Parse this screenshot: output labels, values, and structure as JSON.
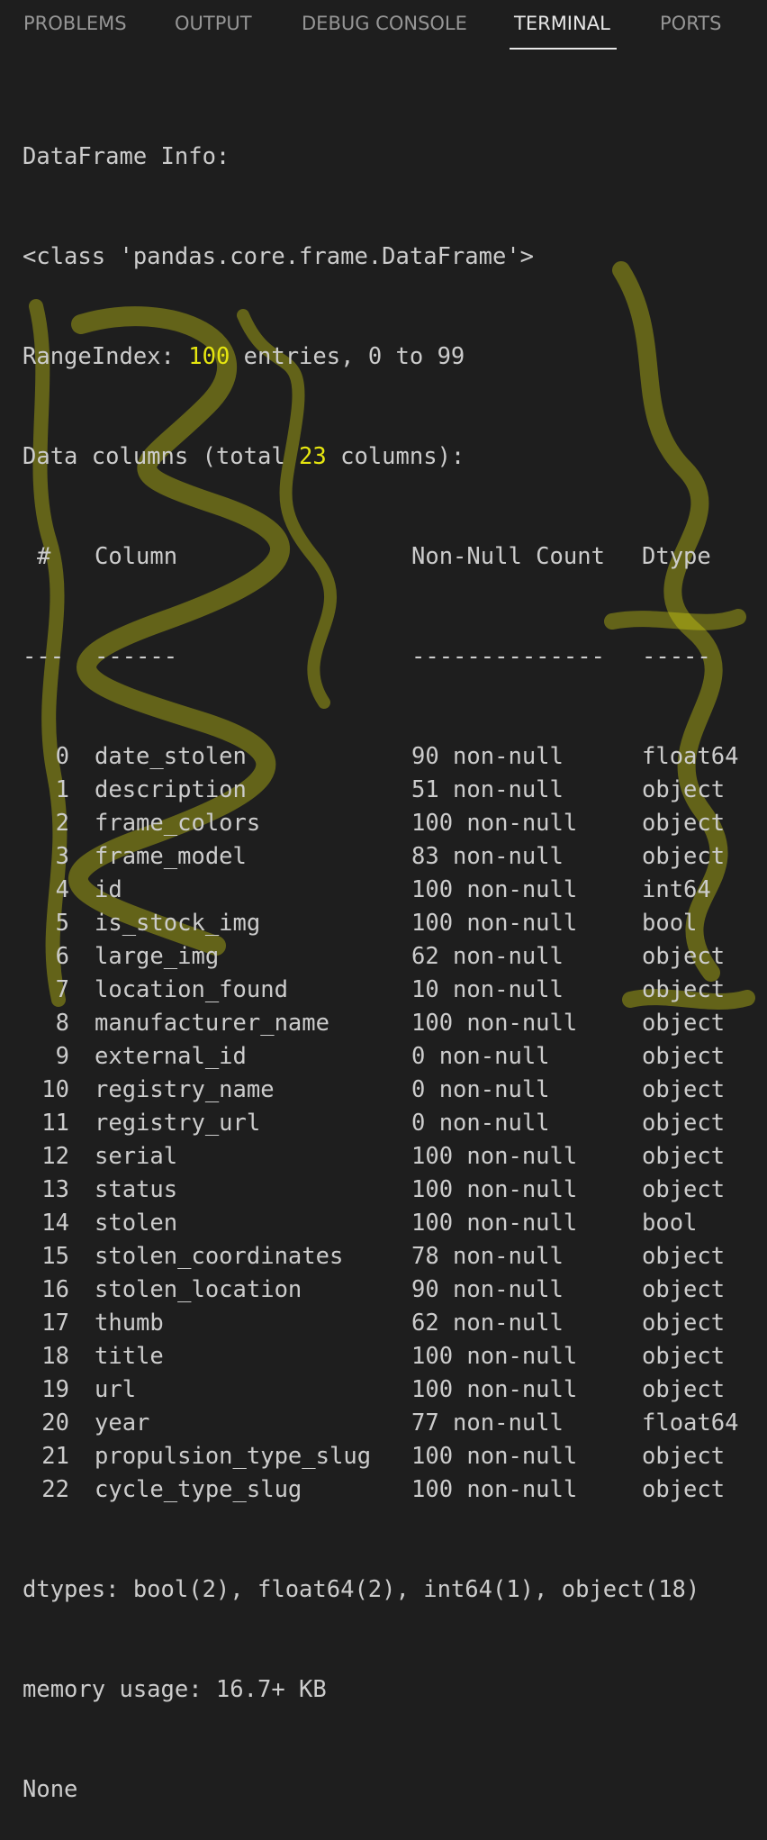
{
  "tabs": {
    "problems": "PROBLEMS",
    "output": "OUTPUT",
    "debug_console": "DEBUG CONSOLE",
    "terminal": "TERMINAL",
    "ports": "PORTS"
  },
  "colors": {
    "background": "#1e1e1e",
    "text": "#cccccc",
    "highlight_yellow": "#e5e510",
    "active_tab": "#e7e7e7",
    "inactive_tab": "#969696"
  },
  "terminal": {
    "line1": "DataFrame Info:",
    "line2": "<class 'pandas.core.frame.DataFrame'>",
    "range_prefix": "RangeIndex: ",
    "range_entries": "100",
    "range_suffix": " entries, 0 to 99",
    "cols_prefix": "Data columns (total ",
    "cols_total": "23",
    "cols_suffix": " columns):",
    "header": {
      "idx": "#",
      "column": "Column",
      "count": "Non-Null Count",
      "dtype": "Dtype"
    },
    "separator": {
      "idx": "---",
      "column": "------",
      "count": "--------------",
      "dtype": "-----"
    },
    "rows": [
      {
        "idx": "0",
        "name": "date_stolen",
        "count": "90 non-null",
        "dtype": "float64"
      },
      {
        "idx": "1",
        "name": "description",
        "count": "51 non-null",
        "dtype": "object"
      },
      {
        "idx": "2",
        "name": "frame_colors",
        "count": "100 non-null",
        "dtype": "object"
      },
      {
        "idx": "3",
        "name": "frame_model",
        "count": "83 non-null",
        "dtype": "object"
      },
      {
        "idx": "4",
        "name": "id",
        "count": "100 non-null",
        "dtype": "int64"
      },
      {
        "idx": "5",
        "name": "is_stock_img",
        "count": "100 non-null",
        "dtype": "bool"
      },
      {
        "idx": "6",
        "name": "large_img",
        "count": "62 non-null",
        "dtype": "object"
      },
      {
        "idx": "7",
        "name": "location_found",
        "count": "10 non-null",
        "dtype": "object"
      },
      {
        "idx": "8",
        "name": "manufacturer_name",
        "count": "100 non-null",
        "dtype": "object"
      },
      {
        "idx": "9",
        "name": "external_id",
        "count": "0 non-null",
        "dtype": "object"
      },
      {
        "idx": "10",
        "name": "registry_name",
        "count": "0 non-null",
        "dtype": "object"
      },
      {
        "idx": "11",
        "name": "registry_url",
        "count": "0 non-null",
        "dtype": "object"
      },
      {
        "idx": "12",
        "name": "serial",
        "count": "100 non-null",
        "dtype": "object"
      },
      {
        "idx": "13",
        "name": "status",
        "count": "100 non-null",
        "dtype": "object"
      },
      {
        "idx": "14",
        "name": "stolen",
        "count": "100 non-null",
        "dtype": "bool"
      },
      {
        "idx": "15",
        "name": "stolen_coordinates",
        "count": "78 non-null",
        "dtype": "object"
      },
      {
        "idx": "16",
        "name": "stolen_location",
        "count": "90 non-null",
        "dtype": "object"
      },
      {
        "idx": "17",
        "name": "thumb",
        "count": "62 non-null",
        "dtype": "object"
      },
      {
        "idx": "18",
        "name": "title",
        "count": "100 non-null",
        "dtype": "object"
      },
      {
        "idx": "19",
        "name": "url",
        "count": "100 non-null",
        "dtype": "object"
      },
      {
        "idx": "20",
        "name": "year",
        "count": "77 non-null",
        "dtype": "float64"
      },
      {
        "idx": "21",
        "name": "propulsion_type_slug",
        "count": "100 non-null",
        "dtype": "object"
      },
      {
        "idx": "22",
        "name": "cycle_type_slug",
        "count": "100 non-null",
        "dtype": "object"
      }
    ],
    "dtypes_line": "dtypes: bool(2), float64(2), int64(1), object(18)",
    "memory_line": "memory usage: 16.7+ KB",
    "return_line": "None"
  }
}
